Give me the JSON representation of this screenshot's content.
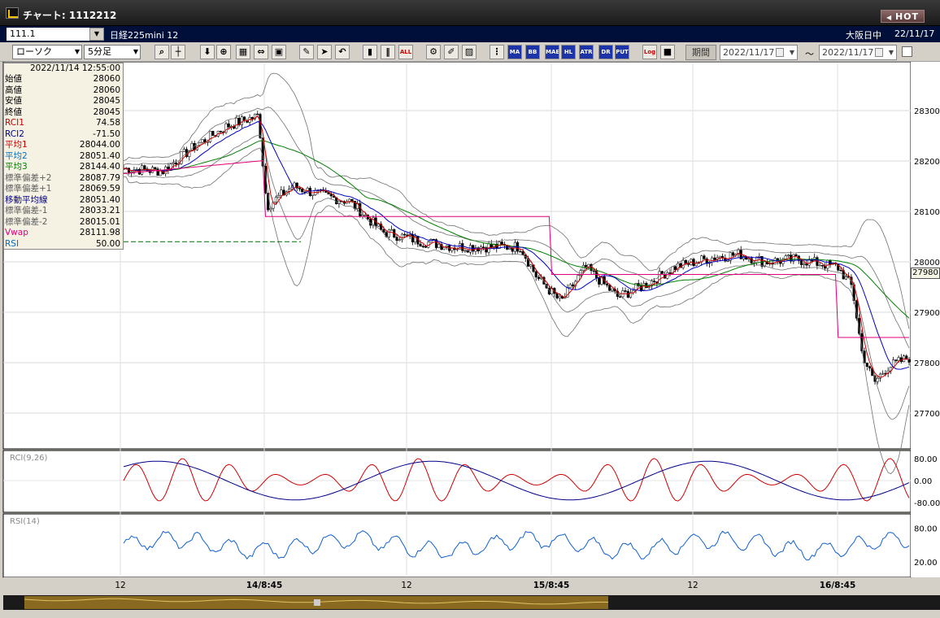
{
  "window": {
    "title": "チャート: 1112212",
    "hot_label": "HOT"
  },
  "symbol": {
    "code": "111.1",
    "name": "日経225mini 12",
    "session": "大阪日中",
    "date": "22/11/17"
  },
  "toolbar": {
    "chart_type": "ローソク",
    "interval": "5分足",
    "buttons": [
      "search",
      "crosshair",
      "down",
      "zoom",
      "chart",
      "arrows",
      "lock",
      "draw",
      "cursor",
      "undo",
      "candle",
      "bars",
      "all",
      "settings",
      "edit",
      "color",
      "jump",
      "ma",
      "bb",
      "mae",
      "hl",
      "atr",
      "dr",
      "put",
      "log",
      "export"
    ],
    "button_labels": {
      "all": "ALL",
      "ma": "MA",
      "bb": "BB",
      "mae": "MAE",
      "hl": "HL",
      "atr": "ATR",
      "dr": "DR",
      "put": "PUT",
      "log": "Log"
    },
    "period_label": "期間",
    "date_from": "2022/11/17",
    "date_to": "2022/11/17",
    "tilde": "〜"
  },
  "info_panel": {
    "datetime": "2022/11/14  12:55:00",
    "rows": [
      {
        "label": "始値",
        "value": "28060",
        "color": "#000000"
      },
      {
        "label": "高値",
        "value": "28060",
        "color": "#000000"
      },
      {
        "label": "安値",
        "value": "28045",
        "color": "#000000"
      },
      {
        "label": "終値",
        "value": "28045",
        "color": "#000000"
      },
      {
        "label": "RCI1",
        "value": "74.58",
        "color": "#c00000"
      },
      {
        "label": "RCI2",
        "value": "-71.50",
        "color": "#00008b"
      },
      {
        "label": "平均1",
        "value": "28044.00",
        "color": "#d00000"
      },
      {
        "label": "平均2",
        "value": "28051.40",
        "color": "#0070c0"
      },
      {
        "label": "平均3",
        "value": "28144.40",
        "color": "#008000"
      },
      {
        "label": "標準偏差+2",
        "value": "28087.79",
        "color": "#606060"
      },
      {
        "label": "標準偏差+1",
        "value": "28069.59",
        "color": "#606060"
      },
      {
        "label": "移動平均線",
        "value": "28051.40",
        "color": "#00008b"
      },
      {
        "label": "標準偏差-1",
        "value": "28033.21",
        "color": "#606060"
      },
      {
        "label": "標準偏差-2",
        "value": "28015.01",
        "color": "#606060"
      },
      {
        "label": "Vwap",
        "value": "28111.98",
        "color": "#e0007a"
      },
      {
        "label": "RSI",
        "value": "50.00",
        "color": "#0070c0"
      }
    ]
  },
  "chart": {
    "current_price": "27980",
    "price_axis": [
      "28300",
      "28200",
      "28100",
      "28000",
      "27900",
      "27800",
      "27700"
    ],
    "rci_label": "RCI(9,26)",
    "rci_axis": [
      "80.00",
      "0.00",
      "-80.00"
    ],
    "rsi_label": "RSI(14)",
    "rsi_axis": [
      "80.00",
      "20.00"
    ],
    "time_axis": [
      "12",
      "14/8:45",
      "12",
      "15/8:45",
      "12",
      "16/8:45"
    ]
  },
  "colors": {
    "candle_up": "#ffffff",
    "candle_down": "#000000",
    "ma1": "#d00000",
    "ma2": "#0000c8",
    "ma3": "#008000",
    "vwap": "#e0007a",
    "bands": "#707070",
    "rci1": "#d00000",
    "rci2": "#00008b",
    "rsi": "#1060d0"
  }
}
